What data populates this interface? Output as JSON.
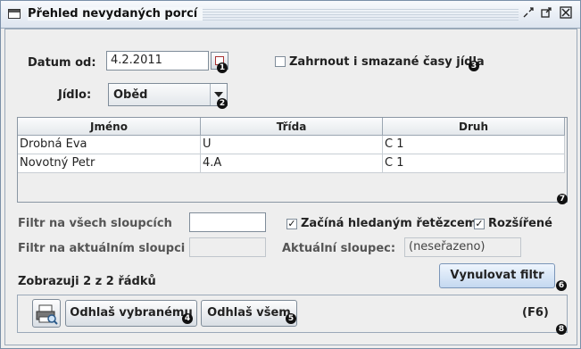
{
  "window": {
    "title": "Přehled nevydaných porcí",
    "controls": [
      "minimize-icon",
      "maximize-icon",
      "close-icon"
    ]
  },
  "filter": {
    "date_label": "Datum od:",
    "date_value": "4.2.2011",
    "include_deleted_label": "Zahrnout i smazané časy jídla",
    "include_deleted_checked": false,
    "meal_label": "Jídlo:",
    "meal_value": "Oběd"
  },
  "table": {
    "columns": [
      "Jméno",
      "Třída",
      "Druh"
    ],
    "rows": [
      [
        "Drobná Eva",
        "U",
        "C 1"
      ],
      [
        "Novotný Petr",
        "4.A",
        "C 1"
      ]
    ]
  },
  "search": {
    "all_columns_label": "Filtr na všech sloupcích",
    "all_columns_value": "",
    "current_column_label": "Filtr na aktuálním sloupci",
    "current_column_value": "",
    "starts_with_label": "Začíná hledaným řetězcem",
    "starts_with_checked": true,
    "extended_label": "Rozšířené",
    "extended_checked": true,
    "current_column_caption": "Aktuální sloupec:",
    "current_column_name": "(neseřazeno)",
    "rows_info": "Zobrazuji 2 z 2 řádků",
    "reset_button": "Vynulovat filtr"
  },
  "actions": {
    "print_icon": "print-preview-icon",
    "logout_selected": "Odhlaš vybranému",
    "logout_all": "Odhlaš všem",
    "shortcut": "(F6)"
  },
  "badges": [
    "1",
    "2",
    "3",
    "4",
    "5",
    "6",
    "7",
    "8"
  ]
}
